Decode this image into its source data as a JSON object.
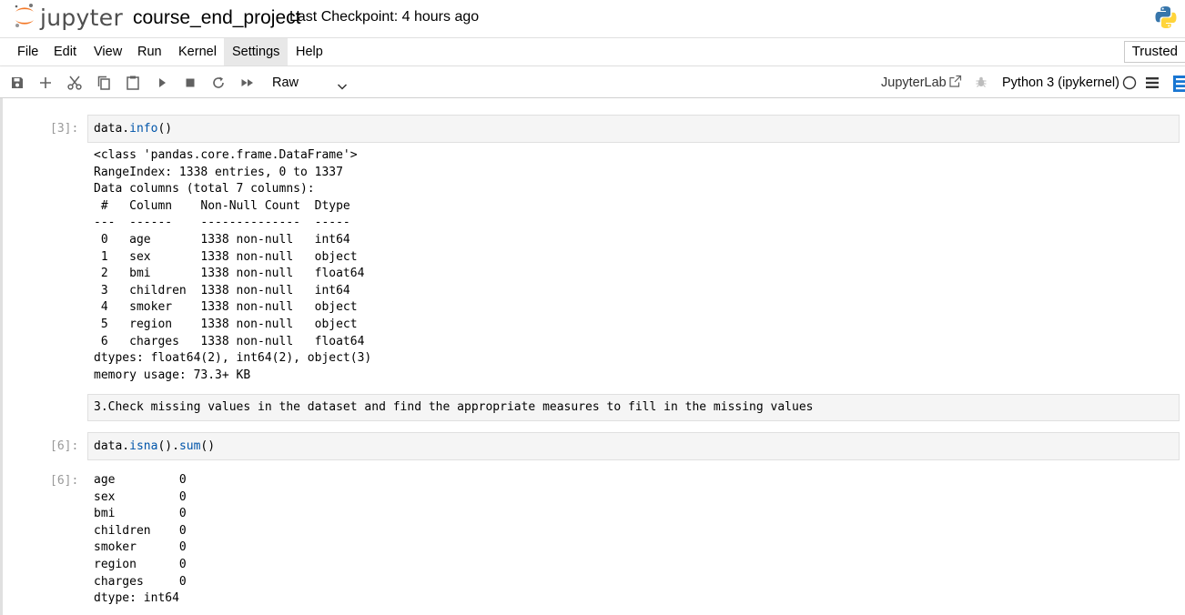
{
  "header": {
    "logo_text": "jupyter",
    "notebook_title": "course_end_project",
    "checkpoint": "Last Checkpoint: 4 hours ago",
    "logo_icon": "jupyter-logo-icon",
    "kernel_logo_icon": "python-logo-icon"
  },
  "menubar": {
    "items": [
      "File",
      "Edit",
      "View",
      "Run",
      "Kernel",
      "Settings",
      "Help"
    ],
    "active": "Settings",
    "trusted": "Trusted"
  },
  "toolbar": {
    "icons": [
      "save-icon",
      "add-cell-icon",
      "cut-icon",
      "copy-icon",
      "paste-icon",
      "run-icon",
      "stop-icon",
      "restart-icon",
      "fast-forward-icon"
    ],
    "cell_type": "Raw",
    "jupyterlab": "JupyterLab",
    "kernel": "Python 3 (ipykernel)"
  },
  "cells": {
    "cell1": {
      "prompt": "[3]:",
      "code_obj": "data.",
      "code_fn": "info",
      "code_rest": "()",
      "output": [
        "<class 'pandas.core.frame.DataFrame'>",
        "RangeIndex: 1338 entries, 0 to 1337",
        "Data columns (total 7 columns):",
        " #   Column    Non-Null Count  Dtype  ",
        "---  ------    --------------  -----  ",
        " 0   age       1338 non-null   int64  ",
        " 1   sex       1338 non-null   object ",
        " 2   bmi       1338 non-null   float64",
        " 3   children  1338 non-null   int64  ",
        " 4   smoker    1338 non-null   object ",
        " 5   region    1338 non-null   object ",
        " 6   charges   1338 non-null   float64",
        "dtypes: float64(2), int64(2), object(3)",
        "memory usage: 73.3+ KB"
      ]
    },
    "markdown": {
      "text": "3.Check missing values in the dataset and find the appropriate measures to fill in the missing values"
    },
    "cell2": {
      "prompt": "[6]:",
      "code_obj": "data.",
      "code_fn1": "isna",
      "code_mid": "().",
      "code_fn2": "sum",
      "code_rest": "()",
      "out_prompt": "[6]:",
      "output": [
        "age         0",
        "sex         0",
        "bmi         0",
        "children    0",
        "smoker      0",
        "region      0",
        "charges     0",
        "dtype: int64"
      ]
    }
  }
}
